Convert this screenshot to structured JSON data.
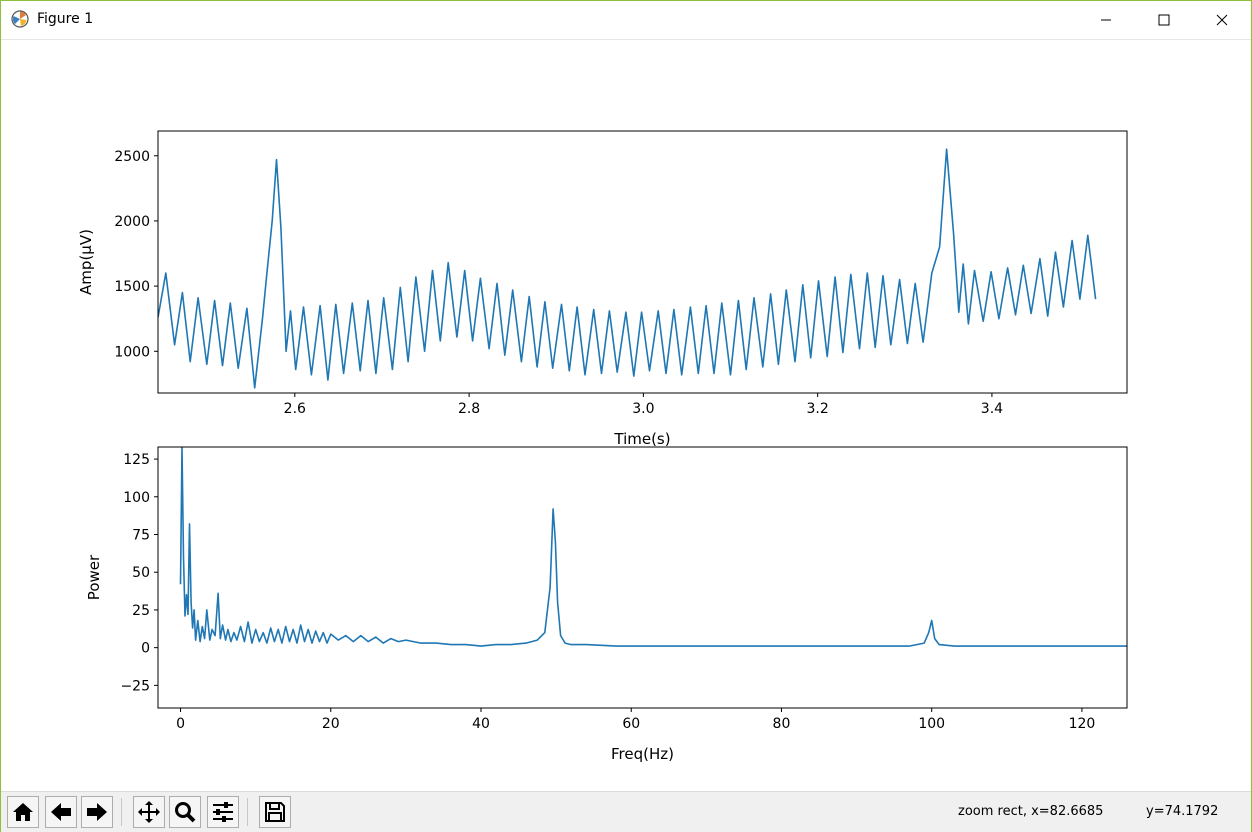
{
  "window": {
    "title": "Figure 1",
    "controls": {
      "minimize": "minimize",
      "maximize": "maximize",
      "close": "close"
    }
  },
  "toolbar": {
    "buttons": [
      {
        "name": "home-button",
        "icon": "home-icon"
      },
      {
        "name": "back-button",
        "icon": "arrow-left-icon"
      },
      {
        "name": "forward-button",
        "icon": "arrow-right-icon"
      },
      {
        "name": "pan-button",
        "icon": "move-icon"
      },
      {
        "name": "zoom-button",
        "icon": "magnifier-icon"
      },
      {
        "name": "configure-subplots-button",
        "icon": "sliders-icon"
      },
      {
        "name": "save-button",
        "icon": "floppy-disk-icon"
      }
    ],
    "status_mode": "zoom rect, x=82.6685",
    "status_y": "y=74.1792"
  },
  "chart_data": [
    {
      "type": "line",
      "xlabel": "Time(s)",
      "ylabel": "Amp(µV)",
      "xlim": [
        2.443,
        3.555
      ],
      "ylim": [
        680,
        2690
      ],
      "xticks": [
        2.6,
        2.8,
        3.0,
        3.2,
        3.4
      ],
      "xtick_labels": [
        "2.6",
        "2.8",
        "3.0",
        "3.2",
        "3.4"
      ],
      "yticks": [
        1000,
        1500,
        2000,
        2500
      ],
      "ytick_labels": [
        "1000",
        "1500",
        "2000",
        "2500"
      ],
      "color": "#1f77b4",
      "x": [
        2.443,
        2.452,
        2.462,
        2.471,
        2.48,
        2.489,
        2.499,
        2.508,
        2.517,
        2.526,
        2.535,
        2.545,
        2.554,
        2.563,
        2.568,
        2.574,
        2.579,
        2.584,
        2.59,
        2.595,
        2.601,
        2.61,
        2.619,
        2.629,
        2.638,
        2.647,
        2.656,
        2.666,
        2.675,
        2.684,
        2.693,
        2.702,
        2.712,
        2.721,
        2.73,
        2.739,
        2.749,
        2.758,
        2.767,
        2.776,
        2.786,
        2.795,
        2.804,
        2.813,
        2.823,
        2.832,
        2.841,
        2.85,
        2.86,
        2.869,
        2.878,
        2.887,
        2.896,
        2.906,
        2.915,
        2.924,
        2.933,
        2.943,
        2.952,
        2.961,
        2.97,
        2.98,
        2.989,
        2.998,
        3.007,
        3.017,
        3.026,
        3.035,
        3.044,
        3.054,
        3.063,
        3.072,
        3.081,
        3.09,
        3.1,
        3.109,
        3.118,
        3.127,
        3.137,
        3.146,
        3.155,
        3.164,
        3.174,
        3.183,
        3.192,
        3.201,
        3.211,
        3.22,
        3.229,
        3.238,
        3.248,
        3.257,
        3.266,
        3.275,
        3.284,
        3.294,
        3.303,
        3.312,
        3.321,
        3.331,
        3.34,
        3.348,
        3.356,
        3.362,
        3.367,
        3.373,
        3.38,
        3.39,
        3.399,
        3.408,
        3.418,
        3.427,
        3.436,
        3.445,
        3.455,
        3.464,
        3.473,
        3.482,
        3.492,
        3.501,
        3.51,
        3.519,
        3.529,
        3.538,
        3.547,
        3.555
      ],
      "y": [
        1260,
        1600,
        1050,
        1450,
        920,
        1410,
        900,
        1390,
        890,
        1370,
        870,
        1330,
        720,
        1260,
        1600,
        2000,
        2470,
        1950,
        1000,
        1310,
        860,
        1340,
        820,
        1350,
        780,
        1360,
        830,
        1370,
        850,
        1390,
        830,
        1410,
        860,
        1490,
        920,
        1570,
        1000,
        1620,
        1080,
        1680,
        1110,
        1620,
        1080,
        1560,
        1020,
        1520,
        970,
        1470,
        920,
        1420,
        880,
        1380,
        870,
        1360,
        850,
        1340,
        820,
        1320,
        830,
        1310,
        840,
        1300,
        810,
        1300,
        850,
        1310,
        830,
        1320,
        820,
        1340,
        830,
        1350,
        830,
        1370,
        820,
        1390,
        860,
        1410,
        880,
        1440,
        900,
        1470,
        920,
        1510,
        950,
        1540,
        960,
        1570,
        990,
        1590,
        1020,
        1600,
        1030,
        1580,
        1050,
        1550,
        1060,
        1520,
        1070,
        1600,
        1800,
        2550,
        1900,
        1300,
        1670,
        1210,
        1620,
        1230,
        1610,
        1250,
        1640,
        1280,
        1660,
        1290,
        1710,
        1270,
        1760,
        1340,
        1850,
        1400,
        1890,
        1400
      ]
    },
    {
      "type": "line",
      "xlabel": "Freq(Hz)",
      "ylabel": "Power",
      "xlim": [
        -3,
        126
      ],
      "ylim": [
        -40,
        133
      ],
      "xticks": [
        0,
        20,
        40,
        60,
        80,
        100,
        120
      ],
      "xtick_labels": [
        "0",
        "20",
        "40",
        "60",
        "80",
        "100",
        "120"
      ],
      "yticks": [
        -25,
        0,
        25,
        50,
        75,
        100,
        125
      ],
      "ytick_labels": [
        "−25",
        "0",
        "25",
        "50",
        "75",
        "100",
        "125"
      ],
      "color": "#1f77b4",
      "x": [
        0.0,
        0.2,
        0.4,
        0.6,
        0.8,
        1.0,
        1.2,
        1.4,
        1.6,
        1.8,
        2.0,
        2.3,
        2.6,
        2.9,
        3.2,
        3.5,
        3.9,
        4.2,
        4.6,
        5.0,
        5.3,
        5.6,
        6.0,
        6.3,
        6.7,
        7.1,
        7.5,
        8.0,
        8.5,
        9.0,
        9.5,
        10.0,
        10.5,
        11.0,
        11.5,
        12.0,
        12.5,
        13.0,
        13.5,
        14.0,
        14.5,
        15.0,
        15.5,
        16.0,
        16.5,
        17.0,
        17.5,
        18.0,
        18.5,
        19.0,
        19.5,
        20.0,
        21.0,
        22.0,
        23.0,
        24.0,
        25.0,
        26.0,
        27.0,
        28.0,
        29.0,
        30.0,
        32.0,
        34.0,
        36.0,
        38.0,
        40.0,
        42.0,
        44.0,
        46.0,
        47.5,
        48.5,
        49.2,
        49.6,
        49.9,
        50.2,
        50.6,
        51.2,
        52.0,
        54.0,
        58.0,
        62.0,
        66.0,
        70.0,
        74.0,
        78.0,
        82.0,
        86.0,
        90.0,
        94.0,
        97.0,
        99.0,
        99.6,
        100.0,
        100.4,
        101.0,
        103.0,
        108.0,
        113.0,
        118.0,
        122.0,
        126.0
      ],
      "y": [
        42,
        133,
        60,
        21,
        35,
        22,
        82,
        30,
        13,
        25,
        5,
        18,
        4,
        14,
        6,
        25,
        5,
        12,
        8,
        36,
        6,
        15,
        5,
        12,
        4,
        10,
        5,
        14,
        4,
        17,
        3,
        12,
        4,
        10,
        3,
        13,
        4,
        12,
        3,
        14,
        4,
        12,
        3,
        15,
        4,
        12,
        3,
        11,
        4,
        10,
        3,
        9,
        5,
        8,
        4,
        8,
        4,
        7,
        3,
        6,
        4,
        5,
        3,
        3,
        2,
        2,
        1,
        2,
        2,
        3,
        5,
        10,
        40,
        92,
        70,
        30,
        8,
        3,
        2,
        2,
        1,
        1,
        1,
        1,
        1,
        1,
        1,
        1,
        1,
        1,
        1,
        3,
        10,
        18,
        6,
        2,
        1,
        1,
        1,
        1,
        1,
        1
      ]
    }
  ]
}
